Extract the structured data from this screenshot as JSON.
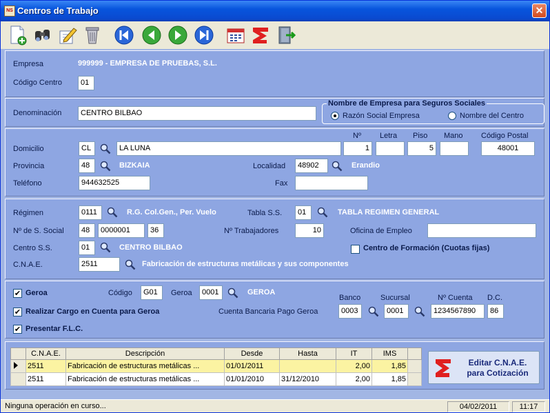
{
  "window": {
    "title": "Centros de Trabajo",
    "close_symbol": "✕"
  },
  "toolbar": {
    "buttons": [
      "new-document-icon",
      "search-binoculars-icon",
      "edit-document-icon",
      "delete-trash-icon",
      "first-record-icon",
      "previous-record-icon",
      "next-record-icon",
      "last-record-icon",
      "calendar-icon",
      "tariff-logo-icon",
      "exit-door-icon"
    ]
  },
  "empresa": {
    "label": "Empresa",
    "value": "999999 - EMPRESA DE PRUEBAS, S.L.",
    "codigo_label": "Código Centro",
    "codigo_value": "01"
  },
  "denominacion": {
    "label": "Denominación",
    "value": "CENTRO BILBAO",
    "group_title": "Nombre de Empresa para Seguros Sociales",
    "option_razon": "Razón Social Empresa",
    "option_centro": "Nombre del Centro"
  },
  "direccion": {
    "domicilio_label": "Domicilio",
    "via_type": "CL",
    "calle": "LA LUNA",
    "numero_label": "Nº",
    "numero": "1",
    "letra_label": "Letra",
    "letra": "",
    "piso_label": "Piso",
    "piso": "5",
    "mano_label": "Mano",
    "mano": "",
    "cp_label": "Código Postal",
    "cp": "48001",
    "provincia_label": "Provincia",
    "provincia_code": "48",
    "provincia_name": "BIZKAIA",
    "localidad_label": "Localidad",
    "localidad_code": "48902",
    "localidad_name": "Erandio",
    "telefono_label": "Teléfono",
    "telefono": "944632525",
    "fax_label": "Fax",
    "fax": ""
  },
  "seguridad": {
    "regimen_label": "Régimen",
    "regimen_code": "0111",
    "regimen_desc": "R.G. Col.Gen., Per. Vuelo",
    "tabla_label": "Tabla S.S.",
    "tabla_code": "01",
    "tabla_desc": "TABLA REGIMEN GENERAL",
    "nss_label": "Nº de S. Social",
    "nss_1": "48",
    "nss_2": "0000001",
    "nss_3": "36",
    "trabajadores_label": "Nº Trabajadores",
    "trabajadores": "10",
    "oficina_label": "Oficina de Empleo",
    "oficina": "",
    "centro_label": "Centro S.S.",
    "centro_code": "01",
    "centro_desc": "CENTRO BILBAO",
    "formacion_label": "Centro de Formación (Cuotas fijas)",
    "cnae_label": "C.N.A.E.",
    "cnae_code": "2511",
    "cnae_desc": "Fabricación de estructuras metálicas y sus componentes"
  },
  "geroa": {
    "check_label": "Geroa",
    "check_mark": "✔",
    "codigo_label": "Código",
    "codigo": "G01",
    "geroa_label": "Geroa",
    "geroa_code": "0001",
    "geroa_name": "GEROA",
    "cargo_label": "Realizar Cargo en Cuenta para Geroa",
    "cuenta_label": "Cuenta Bancaria Pago Geroa",
    "banco_label": "Banco",
    "banco": "0003",
    "sucursal_label": "Sucursal",
    "sucursal": "0001",
    "cuenta_num_label": "Nº Cuenta",
    "cuenta_num": "1234567890",
    "dc_label": "D.C.",
    "dc": "86",
    "flc_label": "Presentar F.L.C."
  },
  "grid": {
    "headers": [
      "C.N.A.E.",
      "Descripción",
      "Desde",
      "Hasta",
      "IT",
      "IMS"
    ],
    "rows": [
      [
        "2511",
        "Fabricación de estructuras metálicas ...",
        "01/01/2011",
        "",
        "2,00",
        "1,85"
      ],
      [
        "2511",
        "Fabricación de estructuras metálicas ...",
        "01/01/2010",
        "31/12/2010",
        "2,00",
        "1,85"
      ]
    ],
    "edit_button": "Editar C.N.A.E. para Cotización"
  },
  "status": {
    "message": "Ninguna operación en curso...",
    "date": "04/02/2011",
    "time": "11:17"
  },
  "colors": {
    "panel": "#8ea6e2",
    "titlebar": "#0855dd",
    "selected_row": "#fbf3a2",
    "bold_value": "#ffffff"
  }
}
